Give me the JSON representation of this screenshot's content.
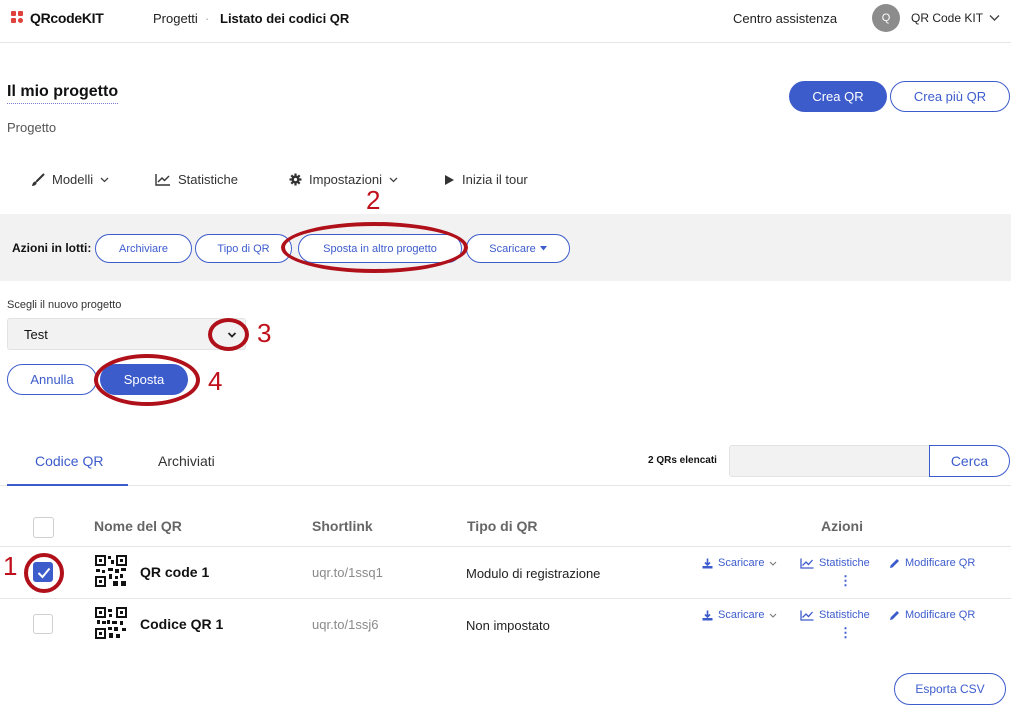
{
  "brand": {
    "logo_text": "QRcodeKIT",
    "logo_color": "#e0413a"
  },
  "header": {
    "breadcrumb_projects": "Progetti",
    "breadcrumb_sep": "·",
    "breadcrumb_current": "Listato dei codici QR",
    "help": "Centro assistenza",
    "avatar_initial": "Q",
    "account_name": "QR Code KIT"
  },
  "project": {
    "title": "Il mio progetto",
    "subtitle": "Progetto",
    "create_qr": "Crea QR",
    "create_many": "Crea più QR"
  },
  "subnav": {
    "templates": "Modelli",
    "statistics": "Statistiche",
    "settings": "Impostazioni",
    "tour": "Inizia il tour"
  },
  "batch": {
    "label": "Azioni in lotti:",
    "archive": "Archiviare",
    "qr_type": "Tipo di QR",
    "move": "Sposta in altro progetto",
    "download": "Scaricare"
  },
  "move_panel": {
    "label": "Scegli il nuovo progetto",
    "selected": "Test",
    "cancel": "Annulla",
    "confirm": "Sposta"
  },
  "annotations": {
    "n1": "1",
    "n2": "2",
    "n3": "3",
    "n4": "4"
  },
  "tabs": {
    "active": "Codice QR",
    "archived": "Archiviati"
  },
  "list": {
    "count": "2 QRs elencati",
    "search_value": "",
    "search_button": "Cerca",
    "columns": {
      "name": "Nome del QR",
      "shortlink": "Shortlink",
      "type": "Tipo di QR",
      "actions": "Azioni"
    },
    "rows": [
      {
        "name": "QR code 1",
        "shortlink": "uqr.to/1ssq1",
        "type": "Modulo di registrazione",
        "checked": true
      },
      {
        "name": "Codice QR 1",
        "shortlink": "uqr.to/1ssj6",
        "type": "Non impostato",
        "checked": false
      }
    ],
    "action_download": "Scaricare",
    "action_stats": "Statistiche",
    "action_edit": "Modificare QR",
    "export": "Esporta CSV"
  },
  "colors": {
    "accent": "#3d5ccc",
    "annotation": "#c0101b"
  }
}
